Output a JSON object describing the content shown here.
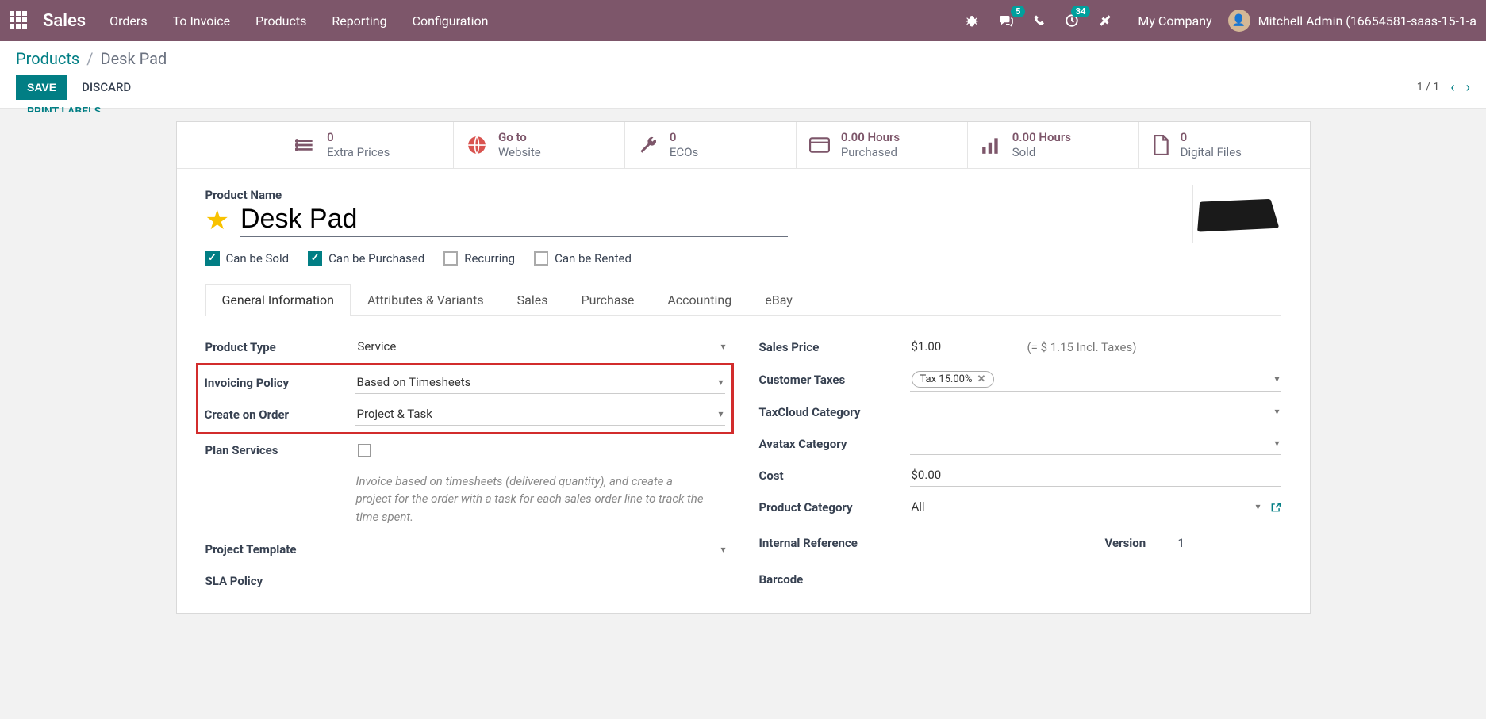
{
  "topbar": {
    "brand": "Sales",
    "menu": [
      "Orders",
      "To Invoice",
      "Products",
      "Reporting",
      "Configuration"
    ],
    "messages_badge": "5",
    "activities_badge": "34",
    "company": "My Company",
    "user": "Mitchell Admin (16654581-saas-15-1-a"
  },
  "breadcrumb": {
    "root": "Products",
    "current": "Desk Pad"
  },
  "actions": {
    "save": "SAVE",
    "discard": "DISCARD",
    "pager": "1 / 1"
  },
  "cutoff": "PRINT LABELS",
  "statbar": [
    {
      "value": "0",
      "label": "Extra Prices",
      "icon": "list"
    },
    {
      "value": "Go to",
      "label": "Website",
      "icon": "globe"
    },
    {
      "value": "0",
      "label": "ECOs",
      "icon": "wrench"
    },
    {
      "value": "0.00 Hours",
      "label": "Purchased",
      "icon": "card"
    },
    {
      "value": "0.00 Hours",
      "label": "Sold",
      "icon": "bars"
    },
    {
      "value": "0",
      "label": "Digital Files",
      "icon": "file"
    }
  ],
  "product": {
    "name_label": "Product Name",
    "name": "Desk Pad",
    "checks": {
      "can_be_sold": "Can be Sold",
      "can_be_purchased": "Can be Purchased",
      "recurring": "Recurring",
      "can_be_rented": "Can be Rented"
    }
  },
  "tabs": [
    "General Information",
    "Attributes & Variants",
    "Sales",
    "Purchase",
    "Accounting",
    "eBay"
  ],
  "left_fields": {
    "product_type": {
      "label": "Product Type",
      "value": "Service"
    },
    "invoicing_policy": {
      "label": "Invoicing Policy",
      "value": "Based on Timesheets"
    },
    "create_on_order": {
      "label": "Create on Order",
      "value": "Project & Task"
    },
    "plan_services": {
      "label": "Plan Services"
    },
    "help": "Invoice based on timesheets (delivered quantity), and create a project for the order with a task for each sales order line to track the time spent.",
    "project_template": {
      "label": "Project Template",
      "value": ""
    },
    "sla_policy": {
      "label": "SLA Policy",
      "value": ""
    }
  },
  "right_fields": {
    "sales_price": {
      "label": "Sales Price",
      "value": "$1.00",
      "incl": "(= $ 1.15 Incl. Taxes)"
    },
    "customer_taxes": {
      "label": "Customer Taxes",
      "tag": "Tax 15.00%"
    },
    "taxcloud": {
      "label": "TaxCloud Category",
      "value": ""
    },
    "avatax": {
      "label": "Avatax Category",
      "value": ""
    },
    "cost": {
      "label": "Cost",
      "value": "$0.00"
    },
    "product_category": {
      "label": "Product Category",
      "value": "All"
    },
    "internal_ref": {
      "label": "Internal Reference",
      "value": ""
    },
    "version": {
      "label": "Version",
      "value": "1"
    },
    "barcode": {
      "label": "Barcode",
      "value": ""
    }
  }
}
